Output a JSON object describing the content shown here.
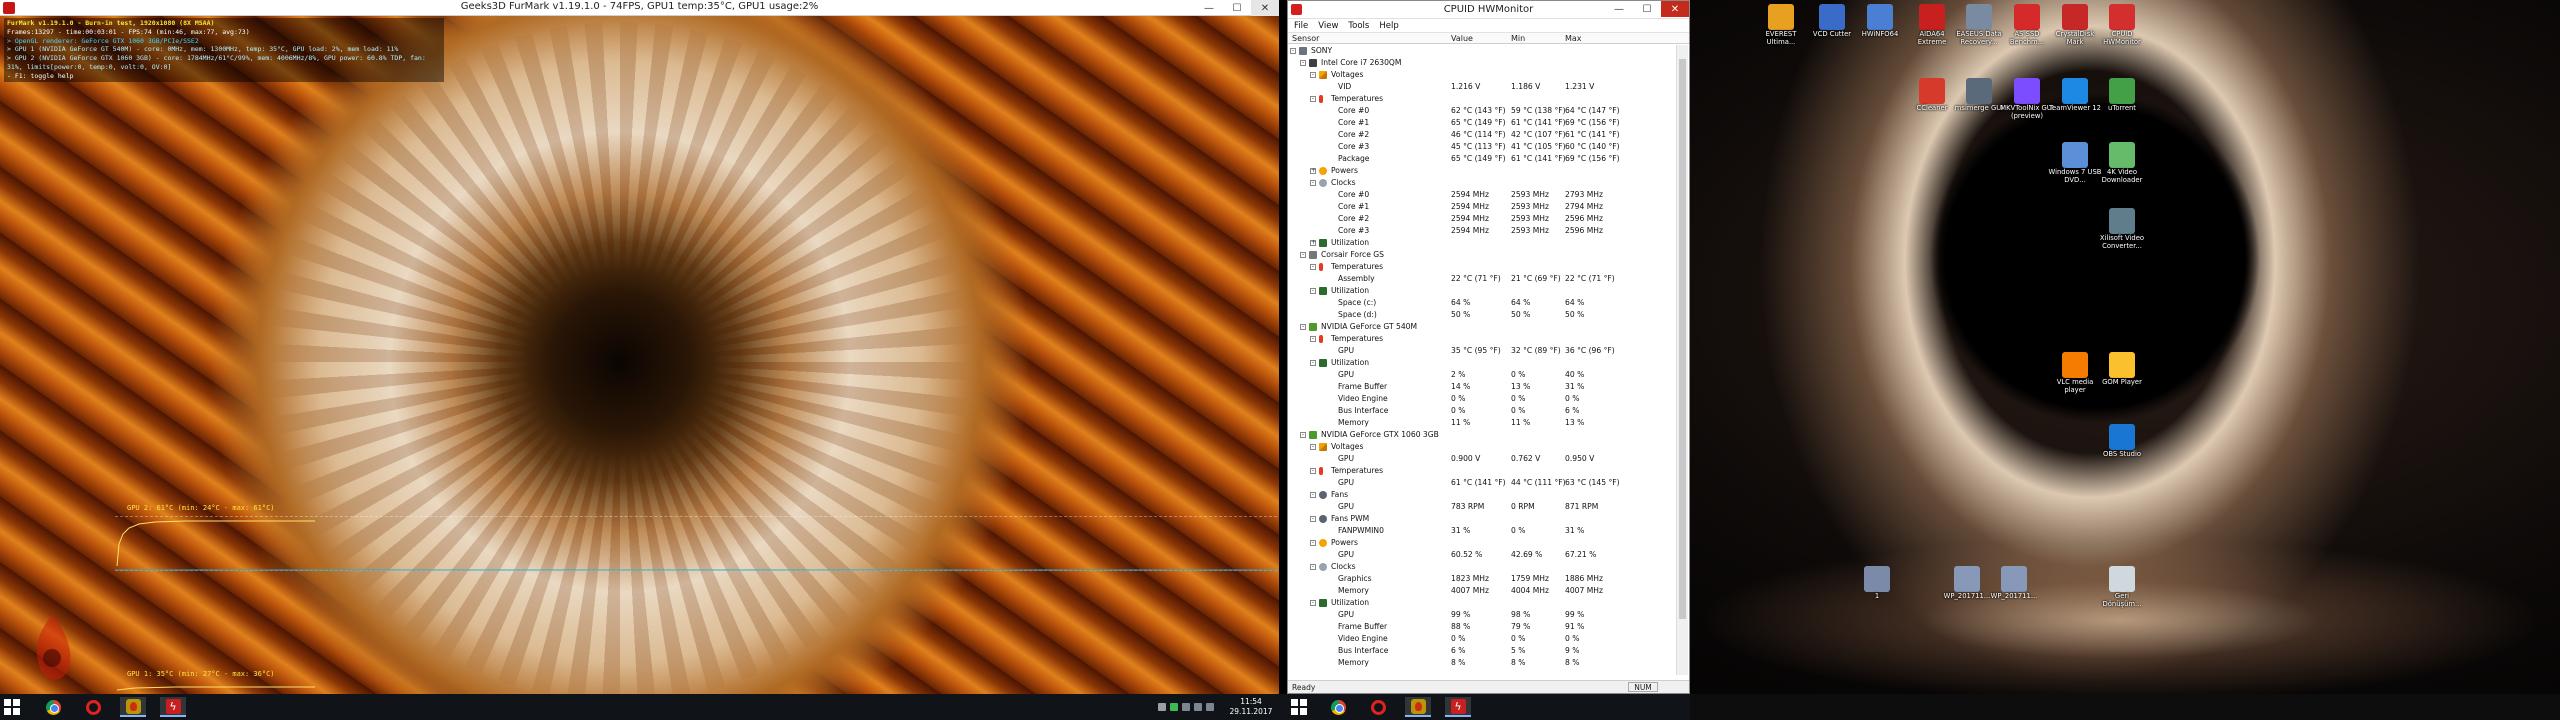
{
  "furmark": {
    "title": "Geeks3D FurMark v1.19.1.0 - 74FPS, GPU1 temp:35°C, GPU1 usage:2%",
    "osd": [
      "FurMark v1.19.1.0 - Burn-in test, 1920x1080 (8X MSAA)",
      "Frames:13297 - time:00:03:01 - FPS:74 (min:46, max:77, avg:73)",
      "> OpenGL renderer: GeForce GTX 1060 3GB/PCIe/SSE2",
      "> GPU 1 (NVIDIA GeForce GT 540M) - core: 0MHz, mem: 1300MHz, temp: 35°C, GPU load: 2%, mem load: 11%",
      "> GPU 2 (NVIDIA GeForce GTX 1060 3GB) - core: 1784MHz/61°C/99%, mem: 4006MHz/8%, GPU power: 60.8% TDP, fan: 31%, limits[power:0, temp:0, volt:0, OV:0]",
      "- F1: toggle help"
    ],
    "graph_gpu2_label": "GPU 2: 61°C (min: 24°C - max: 61°C)",
    "graph_gpu1_label": "GPU 1: 35°C (min: 27°C - max: 36°C)"
  },
  "hwmonitor": {
    "title": "CPUID HWMonitor",
    "menu": [
      "File",
      "View",
      "Tools",
      "Help"
    ],
    "columns": [
      "Sensor",
      "Value",
      "Min",
      "Max"
    ],
    "rows": [
      {
        "depth": 0,
        "icon": "pc",
        "name": "SONY",
        "exp": "-"
      },
      {
        "depth": 1,
        "icon": "chip",
        "name": "Intel Core i7 2630QM",
        "exp": "-"
      },
      {
        "depth": 2,
        "icon": "volt",
        "name": "Voltages",
        "exp": "-"
      },
      {
        "depth": 3,
        "name": "VID",
        "value": "1.216 V",
        "min": "1.186 V",
        "max": "1.231 V"
      },
      {
        "depth": 2,
        "icon": "temp",
        "name": "Temperatures",
        "exp": "-"
      },
      {
        "depth": 3,
        "name": "Core #0",
        "value": "62 °C  (143 °F)",
        "min": "59 °C  (138 °F)",
        "max": "64 °C  (147 °F)"
      },
      {
        "depth": 3,
        "name": "Core #1",
        "value": "65 °C  (149 °F)",
        "min": "61 °C  (141 °F)",
        "max": "69 °C  (156 °F)"
      },
      {
        "depth": 3,
        "name": "Core #2",
        "value": "46 °C  (114 °F)",
        "min": "42 °C  (107 °F)",
        "max": "61 °C  (141 °F)"
      },
      {
        "depth": 3,
        "name": "Core #3",
        "value": "45 °C  (113 °F)",
        "min": "41 °C  (105 °F)",
        "max": "60 °C  (140 °F)"
      },
      {
        "depth": 3,
        "name": "Package",
        "value": "65 °C  (149 °F)",
        "min": "61 °C  (141 °F)",
        "max": "69 °C  (156 °F)"
      },
      {
        "depth": 2,
        "icon": "power",
        "name": "Powers",
        "exp": "+"
      },
      {
        "depth": 2,
        "icon": "clock",
        "name": "Clocks",
        "exp": "-"
      },
      {
        "depth": 3,
        "name": "Core #0",
        "value": "2594 MHz",
        "min": "2593 MHz",
        "max": "2793 MHz"
      },
      {
        "depth": 3,
        "name": "Core #1",
        "value": "2594 MHz",
        "min": "2593 MHz",
        "max": "2794 MHz"
      },
      {
        "depth": 3,
        "name": "Core #2",
        "value": "2594 MHz",
        "min": "2593 MHz",
        "max": "2596 MHz"
      },
      {
        "depth": 3,
        "name": "Core #3",
        "value": "2594 MHz",
        "min": "2593 MHz",
        "max": "2596 MHz"
      },
      {
        "depth": 2,
        "icon": "util",
        "name": "Utilization",
        "exp": "+"
      },
      {
        "depth": 1,
        "icon": "disk",
        "name": "Corsair Force GS",
        "exp": "-"
      },
      {
        "depth": 2,
        "icon": "temp",
        "name": "Temperatures",
        "exp": "-"
      },
      {
        "depth": 3,
        "name": "Assembly",
        "value": "22 °C  (71 °F)",
        "min": "21 °C  (69 °F)",
        "max": "22 °C  (71 °F)"
      },
      {
        "depth": 2,
        "icon": "util",
        "name": "Utilization",
        "exp": "-"
      },
      {
        "depth": 3,
        "name": "Space (c:)",
        "value": "64 %",
        "min": "64 %",
        "max": "64 %"
      },
      {
        "depth": 3,
        "name": "Space (d:)",
        "value": "50 %",
        "min": "50 %",
        "max": "50 %"
      },
      {
        "depth": 1,
        "icon": "gpu",
        "name": "NVIDIA GeForce GT 540M",
        "exp": "-"
      },
      {
        "depth": 2,
        "icon": "temp",
        "name": "Temperatures",
        "exp": "-"
      },
      {
        "depth": 3,
        "name": "GPU",
        "value": "35 °C  (95 °F)",
        "min": "32 °C  (89 °F)",
        "max": "36 °C  (96 °F)"
      },
      {
        "depth": 2,
        "icon": "util",
        "name": "Utilization",
        "exp": "-"
      },
      {
        "depth": 3,
        "name": "GPU",
        "value": "2 %",
        "min": "0 %",
        "max": "40 %"
      },
      {
        "depth": 3,
        "name": "Frame Buffer",
        "value": "14 %",
        "min": "13 %",
        "max": "31 %"
      },
      {
        "depth": 3,
        "name": "Video Engine",
        "value": "0 %",
        "min": "0 %",
        "max": "0 %"
      },
      {
        "depth": 3,
        "name": "Bus Interface",
        "value": "0 %",
        "min": "0 %",
        "max": "6 %"
      },
      {
        "depth": 3,
        "name": "Memory",
        "value": "11 %",
        "min": "11 %",
        "max": "13 %"
      },
      {
        "depth": 1,
        "icon": "gpu",
        "name": "NVIDIA GeForce GTX 1060 3GB",
        "exp": "-"
      },
      {
        "depth": 2,
        "icon": "volt",
        "name": "Voltages",
        "exp": "-"
      },
      {
        "depth": 3,
        "name": "GPU",
        "value": "0.900 V",
        "min": "0.762 V",
        "max": "0.950 V"
      },
      {
        "depth": 2,
        "icon": "temp",
        "name": "Temperatures",
        "exp": "-"
      },
      {
        "depth": 3,
        "name": "GPU",
        "value": "61 °C  (141 °F)",
        "min": "44 °C  (111 °F)",
        "max": "63 °C  (145 °F)"
      },
      {
        "depth": 2,
        "icon": "fan",
        "name": "Fans",
        "exp": "-"
      },
      {
        "depth": 3,
        "name": "GPU",
        "value": "783 RPM",
        "min": "0 RPM",
        "max": "871 RPM"
      },
      {
        "depth": 2,
        "icon": "fan",
        "name": "Fans PWM",
        "exp": "-"
      },
      {
        "depth": 3,
        "name": "FANPWMIN0",
        "value": "31 %",
        "min": "0 %",
        "max": "31 %"
      },
      {
        "depth": 2,
        "icon": "power",
        "name": "Powers",
        "exp": "-"
      },
      {
        "depth": 3,
        "name": "GPU",
        "value": "60.52 %",
        "min": "42.69 %",
        "max": "67.21 %"
      },
      {
        "depth": 2,
        "icon": "clock",
        "name": "Clocks",
        "exp": "-"
      },
      {
        "depth": 3,
        "name": "Graphics",
        "value": "1823 MHz",
        "min": "1759 MHz",
        "max": "1886 MHz"
      },
      {
        "depth": 3,
        "name": "Memory",
        "value": "4007 MHz",
        "min": "4004 MHz",
        "max": "4007 MHz"
      },
      {
        "depth": 2,
        "icon": "util",
        "name": "Utilization",
        "exp": "-"
      },
      {
        "depth": 3,
        "name": "GPU",
        "value": "99 %",
        "min": "98 %",
        "max": "99 %"
      },
      {
        "depth": 3,
        "name": "Frame Buffer",
        "value": "88 %",
        "min": "79 %",
        "max": "91 %"
      },
      {
        "depth": 3,
        "name": "Video Engine",
        "value": "0 %",
        "min": "0 %",
        "max": "0 %"
      },
      {
        "depth": 3,
        "name": "Bus Interface",
        "value": "6 %",
        "min": "5 %",
        "max": "9 %"
      },
      {
        "depth": 3,
        "name": "Memory",
        "value": "8 %",
        "min": "8 %",
        "max": "8 %"
      }
    ],
    "status_ready": "Ready",
    "status_num": "NUM"
  },
  "desktop": {
    "icons": [
      {
        "label": "EVEREST Ultima...",
        "color": "#e8a020"
      },
      {
        "label": "VCD Cutter",
        "color": "#3a6bc8"
      },
      {
        "label": "HWiNFO64",
        "color": "#4a7fd4"
      },
      {
        "label": "AIDA64 Extreme",
        "color": "#c8201e"
      },
      {
        "label": "EASEUS Data Recovery...",
        "color": "#7a8aa0"
      },
      {
        "label": "AS SSD Benchm...",
        "color": "#d42a2a"
      },
      {
        "label": "CrystalDisk Mark",
        "color": "#c62828"
      },
      {
        "label": "CPUID HWMonitor",
        "color": "#d32f2f"
      },
      {
        "label": "CCleaner",
        "color": "#d63a2a"
      },
      {
        "label": "msimerge GUI",
        "color": "#5a6a7a"
      },
      {
        "label": "MKVToolNix GUI (preview)",
        "color": "#7c4dff"
      },
      {
        "label": "TeamViewer 12",
        "color": "#1e88e5"
      },
      {
        "label": "uTorrent",
        "color": "#43a047"
      },
      {
        "label": "Windows 7 USB DVD...",
        "color": "#5b8fd8"
      },
      {
        "label": "4K Video Downloader",
        "color": "#66bb6a"
      },
      {
        "label": "Xilisoft Video Converter...",
        "color": "#607d8b"
      },
      {
        "label": "VLC media player",
        "color": "#f57c00"
      },
      {
        "label": "GOM Player",
        "color": "#fbc02d"
      },
      {
        "label": "OBS Studio",
        "color": "#1976d2"
      },
      {
        "label": "1",
        "color": "#7a8aa8"
      },
      {
        "label": "WP_201711...",
        "color": "#8898b8"
      },
      {
        "label": "WP_201711...",
        "color": "#8898b8"
      },
      {
        "label": "Geri Dönüşüm...",
        "color": "#cfd8dc"
      }
    ]
  },
  "taskbar": {
    "time": "11:54",
    "date": "29.11.2017"
  }
}
